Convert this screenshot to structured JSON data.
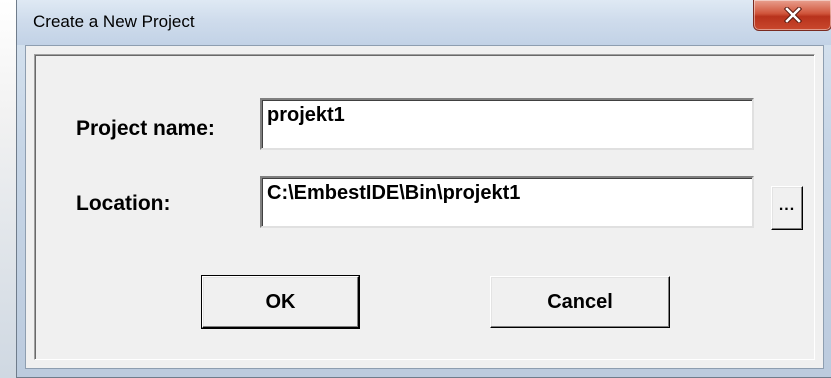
{
  "window": {
    "title": "Create a New Project",
    "close_icon": "close-icon"
  },
  "form": {
    "project_name_label": "Project name:",
    "project_name_value": "projekt1",
    "location_label": "Location:",
    "location_value": "C:\\EmbestIDE\\Bin\\projekt1",
    "browse_label": "..."
  },
  "buttons": {
    "ok_label": "OK",
    "cancel_label": "Cancel"
  },
  "colors": {
    "close_button": "#c9482d",
    "titlebar": "#cfdcec",
    "dialog_background": "#f0f0f0"
  }
}
